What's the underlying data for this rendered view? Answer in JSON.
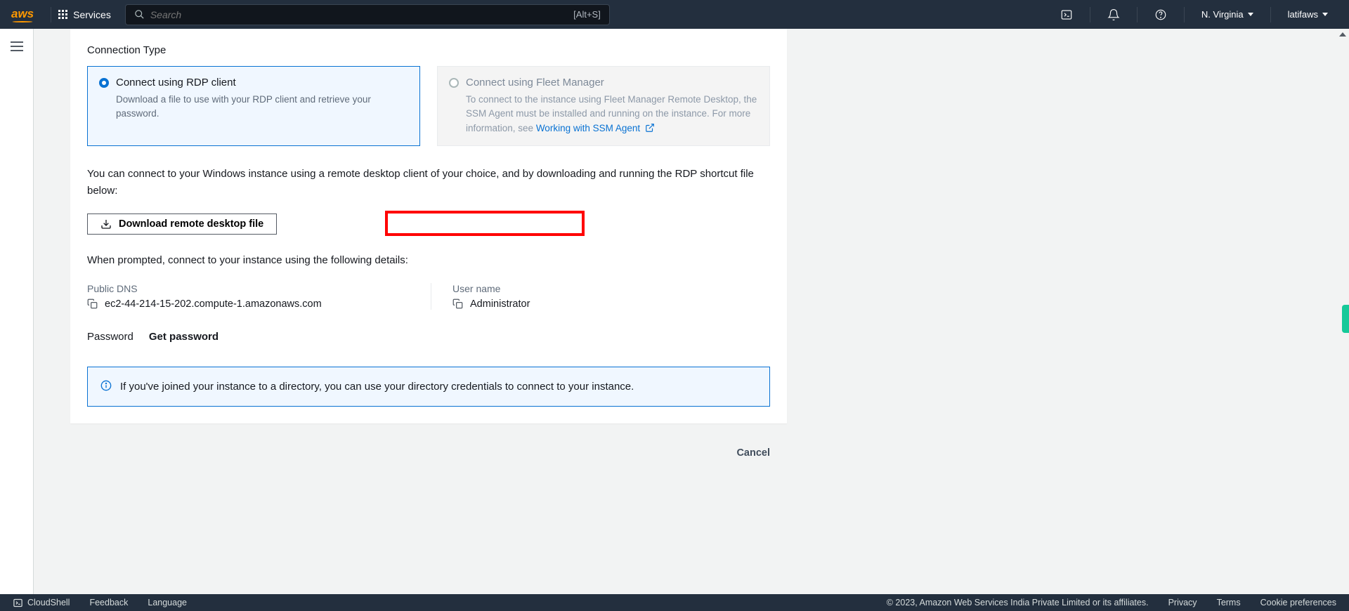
{
  "nav": {
    "logo": "aws",
    "services": "Services",
    "search_placeholder": "Search",
    "search_kbd": "[Alt+S]",
    "region": "N. Virginia",
    "account": "latifaws"
  },
  "main": {
    "section_title": "Connection Type",
    "conn_rdp": {
      "title": "Connect using RDP client",
      "desc": "Download a file to use with your RDP client and retrieve your password."
    },
    "conn_fleet": {
      "title": "Connect using Fleet Manager",
      "desc": "To connect to the instance using Fleet Manager Remote Desktop, the SSM Agent must be installed and running on the instance. For more information, see ",
      "link": "Working with SSM Agent"
    },
    "body_text": "You can connect to your Windows instance using a remote desktop client of your choice, and by downloading and running the RDP shortcut file below:",
    "download_label": "Download remote desktop file",
    "details_intro": "When prompted, connect to your instance using the following details:",
    "public_dns_label": "Public DNS",
    "public_dns_value": "ec2-44-214-15-202.compute-1.amazonaws.com",
    "username_label": "User name",
    "username_value": "Administrator",
    "password_label": "Password",
    "get_password": "Get password",
    "info_text": "If you've joined your instance to a directory, you can use your directory credentials to connect to your instance.",
    "cancel": "Cancel"
  },
  "footer": {
    "cloudshell": "CloudShell",
    "feedback": "Feedback",
    "language": "Language",
    "copyright": "© 2023, Amazon Web Services India Private Limited or its affiliates.",
    "privacy": "Privacy",
    "terms": "Terms",
    "cookies": "Cookie preferences"
  }
}
